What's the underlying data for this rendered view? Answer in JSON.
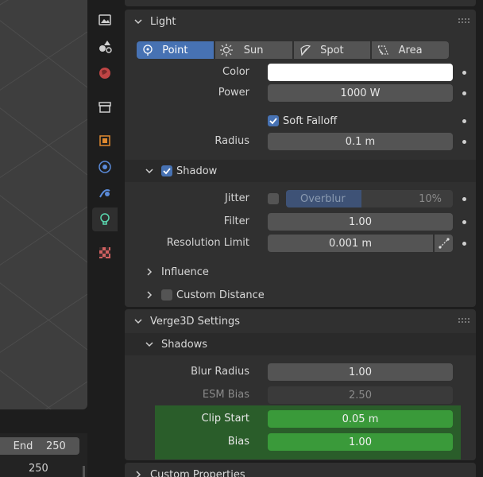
{
  "timeline": {
    "end_label": "End",
    "end_value": "250",
    "current_frame": "250"
  },
  "light_panel": {
    "title": "Light",
    "types": [
      {
        "label": "Point",
        "icon": "point-light-icon",
        "active": true
      },
      {
        "label": "Sun",
        "icon": "sun-icon",
        "active": false
      },
      {
        "label": "Spot",
        "icon": "spot-light-icon",
        "active": false
      },
      {
        "label": "Area",
        "icon": "area-light-icon",
        "active": false
      }
    ],
    "color_label": "Color",
    "color_value": "#ffffff",
    "power_label": "Power",
    "power_value": "1000 W",
    "soft_falloff_label": "Soft Falloff",
    "radius_label": "Radius",
    "radius_value": "0.1 m",
    "shadow": {
      "label": "Shadow",
      "jitter_label": "Jitter",
      "overblur_label": "Overblur",
      "overblur_value": "10%",
      "overblur_fraction": 0.45,
      "filter_label": "Filter",
      "filter_value": "1.00",
      "resolution_label": "Resolution Limit",
      "resolution_value": "0.001 m"
    },
    "influence_label": "Influence",
    "custom_distance_label": "Custom Distance"
  },
  "verge_panel": {
    "title": "Verge3D Settings",
    "shadows_label": "Shadows",
    "blur_radius_label": "Blur Radius",
    "blur_radius_value": "1.00",
    "esm_bias_label": "ESM Bias",
    "esm_bias_value": "2.50",
    "clip_start_label": "Clip Start",
    "clip_start_value": "0.05 m",
    "bias_label": "Bias",
    "bias_value": "1.00"
  },
  "custom_props_label": "Custom Properties",
  "colors": {
    "accent": "#4772b3",
    "highlight_green": "#2a5d2a",
    "field_green": "#3a9a3a"
  }
}
